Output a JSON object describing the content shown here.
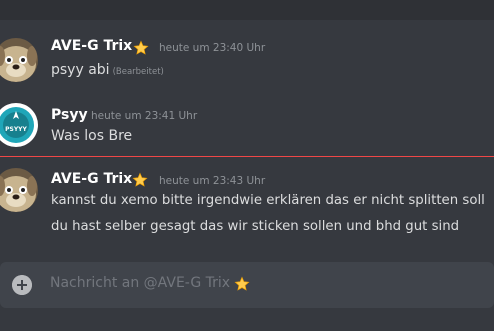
{
  "messages": [
    {
      "author": "AVE-G Trix",
      "author_badge": "star-emoji",
      "timestamp": "heute um 23:40 Uhr",
      "lines": [
        "psyy abi"
      ],
      "edited_label": "(Bearbeitet)",
      "avatar": "dog-avatar"
    },
    {
      "author": "Psyy",
      "timestamp": "heute um 23:41 Uhr",
      "lines": [
        "Was los Bre"
      ],
      "avatar": "psyy-logo-avatar",
      "avatar_text": "PSYYY"
    },
    {
      "author": "AVE-G Trix",
      "author_badge": "star-emoji",
      "timestamp": "heute um 23:43 Uhr",
      "lines": [
        "kannst du xemo bitte irgendwie erklären das er nicht splitten soll",
        "du hast selber gesagt das wir sticken sollen und bhd gut sind"
      ],
      "avatar": "dog-avatar"
    }
  ],
  "composer": {
    "placeholder": "Nachricht an @AVE-G Trix",
    "placeholder_badge": "star-emoji",
    "attach_icon": "plus-circle-icon"
  },
  "colors": {
    "background": "#36393f",
    "composer_bg": "#40444b",
    "new_messages_divider": "#f04747",
    "username": "#ffffff",
    "timestamp": "#8e9297",
    "message_text": "#dcddde"
  }
}
